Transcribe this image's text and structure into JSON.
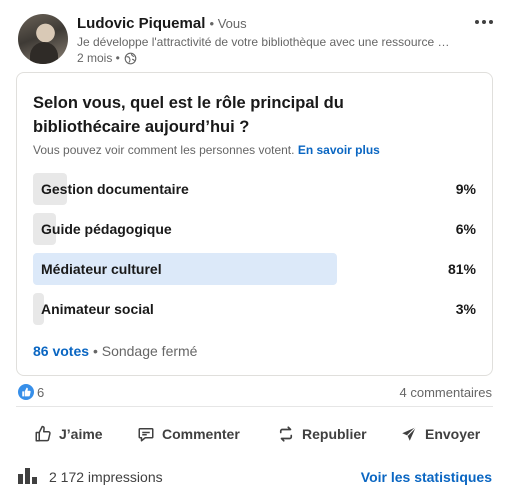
{
  "author": {
    "name": "Ludovic Piquemal",
    "degree": "• Vous",
    "headline": "Je développe l'attractivité de votre bibliothèque avec une ressource …",
    "time": "2 mois •"
  },
  "poll": {
    "question": "Selon vous, quel est le rôle principal du bibliothécaire aujourd’hui ?",
    "note": "Vous pouvez voir comment les personnes votent.",
    "learn_more": "En savoir plus",
    "options": [
      {
        "label": "Gestion documentaire",
        "percent_text": "9%",
        "share": 0.09
      },
      {
        "label": "Guide pédagogique",
        "percent_text": "6%",
        "share": 0.06
      },
      {
        "label": "Médiateur culturel",
        "percent_text": "81%",
        "share": 0.81,
        "selected": true
      },
      {
        "label": "Animateur social",
        "percent_text": "3%",
        "share": 0.03
      }
    ],
    "votes": "86 votes",
    "status": "• Sondage fermé"
  },
  "social": {
    "likes": "6",
    "comments": "4 commentaires"
  },
  "actions": {
    "like": "J’aime",
    "comment": "Commenter",
    "repost": "Republier",
    "send": "Envoyer"
  },
  "stats": {
    "impressions": "2 172 impressions",
    "link": "Voir les statistiques"
  },
  "colors": {
    "accent": "#0a66c2",
    "bar": "#e8e8e8",
    "bar_selected": "#dce9f9",
    "like_badge": "#378fe9"
  }
}
